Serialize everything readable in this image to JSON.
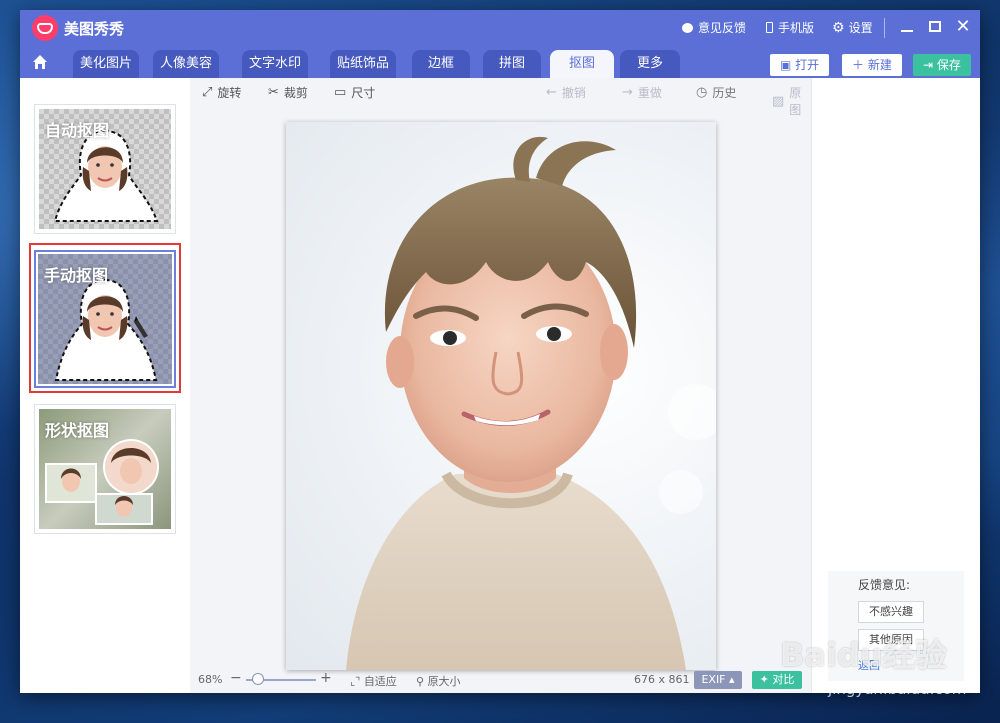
{
  "app": {
    "title": "美图秀秀"
  },
  "titlebar": {
    "feedback": "意见反馈",
    "mobile": "手机版",
    "settings": "设置"
  },
  "tabs": [
    {
      "label": "美化图片"
    },
    {
      "label": "人像美容"
    },
    {
      "label": "文字水印"
    },
    {
      "label": "贴纸饰品"
    },
    {
      "label": "边框"
    },
    {
      "label": "拼图"
    },
    {
      "label": "抠图",
      "active": true
    },
    {
      "label": "更多"
    }
  ],
  "actions": {
    "open": "打开",
    "new": "新建",
    "save": "保存"
  },
  "modes": [
    {
      "label": "自动抠图"
    },
    {
      "label": "手动抠图",
      "selected": true
    },
    {
      "label": "形状抠图"
    }
  ],
  "tools": {
    "rotate": "旋转",
    "crop": "裁剪",
    "size": "尺寸",
    "undo": "撤销",
    "redo": "重做",
    "history": "历史",
    "original": "原图"
  },
  "status": {
    "zoom": "68%",
    "fit": "自适应",
    "actual": "原大小",
    "dimensions": "676 x 861",
    "exif": "EXIF",
    "compare": "对比"
  },
  "feedback": {
    "title": "反馈意见:",
    "option1": "不感兴趣",
    "option2": "其他原因",
    "link": "返回"
  },
  "watermark": {
    "brand": "Baidu经验",
    "url": "jingyan.baidu.com"
  },
  "colors": {
    "primary": "#5b6fd6",
    "save": "#3cc1a0",
    "selection": "#e53935"
  },
  "icons": [
    "home-icon",
    "feedback-icon",
    "phone-icon",
    "gear-icon",
    "minimize-icon",
    "maximize-icon",
    "close-icon",
    "rotate-icon",
    "crop-icon",
    "size-icon",
    "undo-icon",
    "redo-icon",
    "history-icon",
    "original-icon"
  ]
}
